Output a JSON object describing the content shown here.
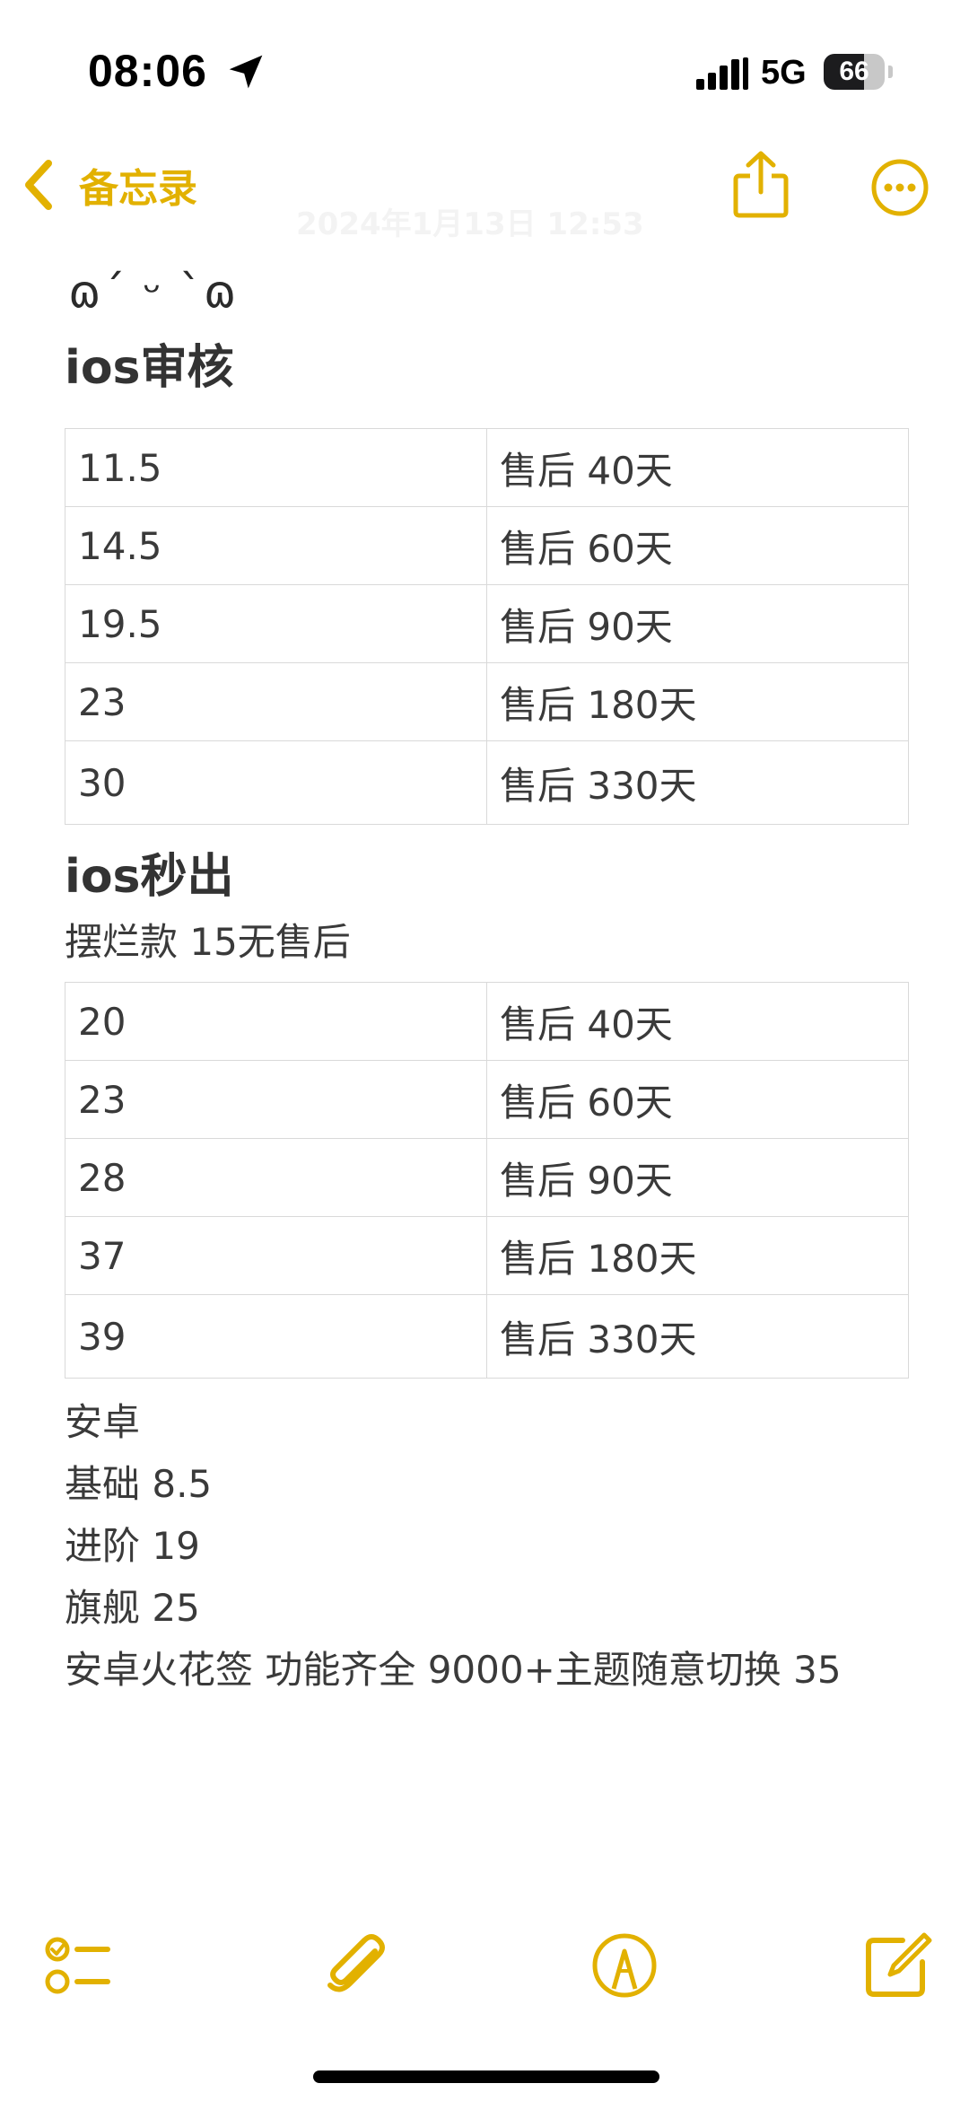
{
  "status_bar": {
    "time": "08:06",
    "network": "5G",
    "battery": "66"
  },
  "nav": {
    "back_label": "备忘录",
    "faded_title": "2024年1月13日 12:53"
  },
  "note": {
    "kaomoji": "ɷ´ ᵕ `ɷ",
    "section1_heading": "ios审核",
    "table1": [
      [
        "11.5",
        "售后 40天"
      ],
      [
        "14.5",
        "售后 60天"
      ],
      [
        "19.5",
        "售后 90天"
      ],
      [
        "23",
        "售后 180天"
      ],
      [
        "30",
        "售后 330天"
      ]
    ],
    "section2_heading": "ios秒出",
    "section2_subtitle": "摆烂款 15无售后",
    "table2": [
      [
        "20",
        "售后 40天"
      ],
      [
        "23",
        "售后 60天"
      ],
      [
        "28",
        "售后 90天"
      ],
      [
        "37",
        "售后 180天"
      ],
      [
        "39",
        "售后 330天"
      ]
    ],
    "lines": [
      "安卓",
      "基础 8.5",
      "进阶 19",
      "旗舰 25",
      "安卓火花签 功能齐全 9000+主题随意切换 35"
    ]
  },
  "colors": {
    "accent": "#e2b100",
    "table_border": "#d9d9d9",
    "text": "#3a3a3a"
  },
  "icons": {
    "back": "chevron-left-icon",
    "share": "share-icon",
    "more": "ellipsis-circle-icon",
    "checklist": "checklist-icon",
    "attach": "paperclip-icon",
    "markup": "markup-pen-icon",
    "compose": "compose-icon"
  }
}
